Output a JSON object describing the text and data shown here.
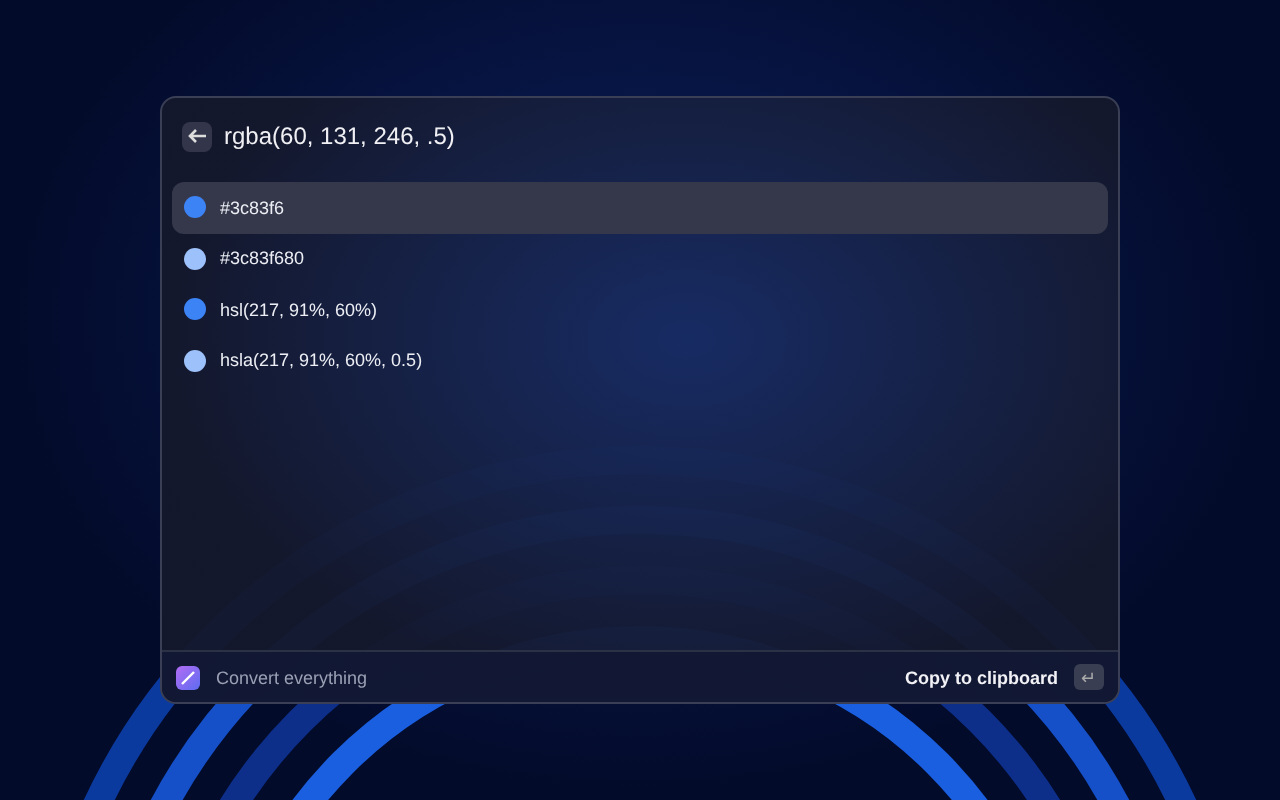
{
  "search": {
    "value": "rgba(60, 131, 246, .5)"
  },
  "results": [
    {
      "label": "#3c83f6",
      "color": "#3c83f6",
      "selected": true
    },
    {
      "label": "#3c83f680",
      "color": "#9dc1fa",
      "selected": false
    },
    {
      "label": "hsl(217, 91%, 60%)",
      "color": "#3c83f6",
      "selected": false
    },
    {
      "label": "hsla(217, 91%, 60%, 0.5)",
      "color": "#9dc1fa",
      "selected": false
    }
  ],
  "footer": {
    "command": "Convert everything",
    "action": "Copy to clipboard",
    "shortcut": "↵"
  }
}
